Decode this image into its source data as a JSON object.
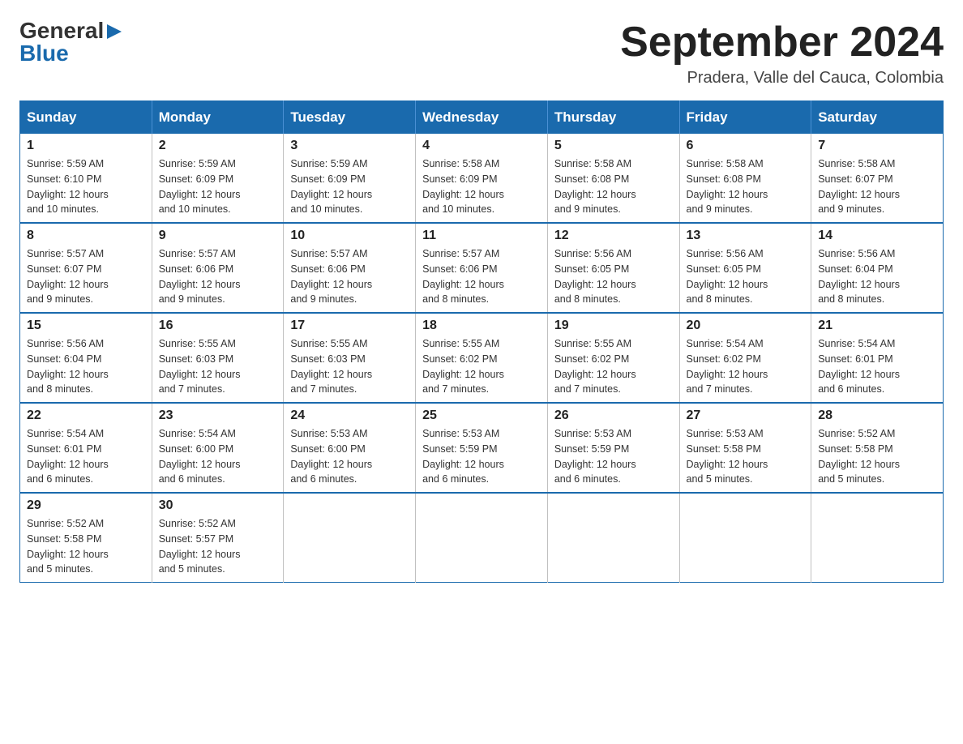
{
  "header": {
    "logo_general": "General",
    "logo_blue": "Blue",
    "month_title": "September 2024",
    "location": "Pradera, Valle del Cauca, Colombia"
  },
  "days_of_week": [
    "Sunday",
    "Monday",
    "Tuesday",
    "Wednesday",
    "Thursday",
    "Friday",
    "Saturday"
  ],
  "weeks": [
    [
      {
        "day": "1",
        "sunrise": "5:59 AM",
        "sunset": "6:10 PM",
        "daylight": "12 hours and 10 minutes."
      },
      {
        "day": "2",
        "sunrise": "5:59 AM",
        "sunset": "6:09 PM",
        "daylight": "12 hours and 10 minutes."
      },
      {
        "day": "3",
        "sunrise": "5:59 AM",
        "sunset": "6:09 PM",
        "daylight": "12 hours and 10 minutes."
      },
      {
        "day": "4",
        "sunrise": "5:58 AM",
        "sunset": "6:09 PM",
        "daylight": "12 hours and 10 minutes."
      },
      {
        "day": "5",
        "sunrise": "5:58 AM",
        "sunset": "6:08 PM",
        "daylight": "12 hours and 9 minutes."
      },
      {
        "day": "6",
        "sunrise": "5:58 AM",
        "sunset": "6:08 PM",
        "daylight": "12 hours and 9 minutes."
      },
      {
        "day": "7",
        "sunrise": "5:58 AM",
        "sunset": "6:07 PM",
        "daylight": "12 hours and 9 minutes."
      }
    ],
    [
      {
        "day": "8",
        "sunrise": "5:57 AM",
        "sunset": "6:07 PM",
        "daylight": "12 hours and 9 minutes."
      },
      {
        "day": "9",
        "sunrise": "5:57 AM",
        "sunset": "6:06 PM",
        "daylight": "12 hours and 9 minutes."
      },
      {
        "day": "10",
        "sunrise": "5:57 AM",
        "sunset": "6:06 PM",
        "daylight": "12 hours and 9 minutes."
      },
      {
        "day": "11",
        "sunrise": "5:57 AM",
        "sunset": "6:06 PM",
        "daylight": "12 hours and 8 minutes."
      },
      {
        "day": "12",
        "sunrise": "5:56 AM",
        "sunset": "6:05 PM",
        "daylight": "12 hours and 8 minutes."
      },
      {
        "day": "13",
        "sunrise": "5:56 AM",
        "sunset": "6:05 PM",
        "daylight": "12 hours and 8 minutes."
      },
      {
        "day": "14",
        "sunrise": "5:56 AM",
        "sunset": "6:04 PM",
        "daylight": "12 hours and 8 minutes."
      }
    ],
    [
      {
        "day": "15",
        "sunrise": "5:56 AM",
        "sunset": "6:04 PM",
        "daylight": "12 hours and 8 minutes."
      },
      {
        "day": "16",
        "sunrise": "5:55 AM",
        "sunset": "6:03 PM",
        "daylight": "12 hours and 7 minutes."
      },
      {
        "day": "17",
        "sunrise": "5:55 AM",
        "sunset": "6:03 PM",
        "daylight": "12 hours and 7 minutes."
      },
      {
        "day": "18",
        "sunrise": "5:55 AM",
        "sunset": "6:02 PM",
        "daylight": "12 hours and 7 minutes."
      },
      {
        "day": "19",
        "sunrise": "5:55 AM",
        "sunset": "6:02 PM",
        "daylight": "12 hours and 7 minutes."
      },
      {
        "day": "20",
        "sunrise": "5:54 AM",
        "sunset": "6:02 PM",
        "daylight": "12 hours and 7 minutes."
      },
      {
        "day": "21",
        "sunrise": "5:54 AM",
        "sunset": "6:01 PM",
        "daylight": "12 hours and 6 minutes."
      }
    ],
    [
      {
        "day": "22",
        "sunrise": "5:54 AM",
        "sunset": "6:01 PM",
        "daylight": "12 hours and 6 minutes."
      },
      {
        "day": "23",
        "sunrise": "5:54 AM",
        "sunset": "6:00 PM",
        "daylight": "12 hours and 6 minutes."
      },
      {
        "day": "24",
        "sunrise": "5:53 AM",
        "sunset": "6:00 PM",
        "daylight": "12 hours and 6 minutes."
      },
      {
        "day": "25",
        "sunrise": "5:53 AM",
        "sunset": "5:59 PM",
        "daylight": "12 hours and 6 minutes."
      },
      {
        "day": "26",
        "sunrise": "5:53 AM",
        "sunset": "5:59 PM",
        "daylight": "12 hours and 6 minutes."
      },
      {
        "day": "27",
        "sunrise": "5:53 AM",
        "sunset": "5:58 PM",
        "daylight": "12 hours and 5 minutes."
      },
      {
        "day": "28",
        "sunrise": "5:52 AM",
        "sunset": "5:58 PM",
        "daylight": "12 hours and 5 minutes."
      }
    ],
    [
      {
        "day": "29",
        "sunrise": "5:52 AM",
        "sunset": "5:58 PM",
        "daylight": "12 hours and 5 minutes."
      },
      {
        "day": "30",
        "sunrise": "5:52 AM",
        "sunset": "5:57 PM",
        "daylight": "12 hours and 5 minutes."
      },
      null,
      null,
      null,
      null,
      null
    ]
  ]
}
